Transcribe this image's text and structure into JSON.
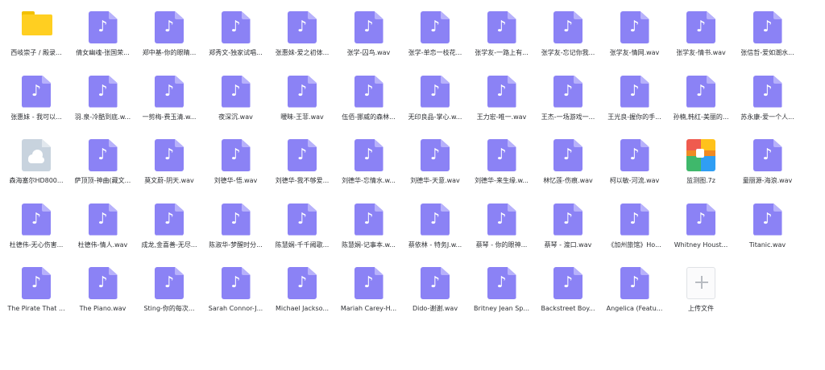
{
  "items": [
    {
      "type": "folder",
      "name": "西岐崇子 / 殿录..."
    },
    {
      "type": "audio",
      "name": "倩女幽魂-张国荣..."
    },
    {
      "type": "audio",
      "name": "郑中基-你的眼睛..."
    },
    {
      "type": "audio",
      "name": "郑秀文-独家试唱..."
    },
    {
      "type": "audio",
      "name": "张惠妹-爱之初体..."
    },
    {
      "type": "audio",
      "name": "张学-囚鸟.wav"
    },
    {
      "type": "audio",
      "name": "张学-单恋一枝花..."
    },
    {
      "type": "audio",
      "name": "张学友-一路上有..."
    },
    {
      "type": "audio",
      "name": "张学友-忘记你我..."
    },
    {
      "type": "audio",
      "name": "张学友-情网.wav"
    },
    {
      "type": "audio",
      "name": "张学友-情书.wav"
    },
    {
      "type": "audio",
      "name": "张信哲-爱如潮水..."
    },
    {
      "type": "audio",
      "name": "张惠妹 - 我可以..."
    },
    {
      "type": "audio",
      "name": "羽.泉-冷酷到底.w..."
    },
    {
      "type": "audio",
      "name": "一剪梅-费玉清.w..."
    },
    {
      "type": "audio",
      "name": "夜深沉.wav"
    },
    {
      "type": "audio",
      "name": "暧昧-王菲.wav"
    },
    {
      "type": "audio",
      "name": "伍佰-挪威的森林..."
    },
    {
      "type": "audio",
      "name": "无印良品-掌心.w..."
    },
    {
      "type": "audio",
      "name": "王力宏-唯一.wav"
    },
    {
      "type": "audio",
      "name": "王杰-一场游戏一..."
    },
    {
      "type": "audio",
      "name": "王光良-握你的手..."
    },
    {
      "type": "audio",
      "name": "孙楠,韩红-美丽的..."
    },
    {
      "type": "audio",
      "name": "苏永康-爱一个人..."
    },
    {
      "type": "cloud",
      "name": "森海塞尔HD800..."
    },
    {
      "type": "audio",
      "name": "萨顶顶-神曲(藏文..."
    },
    {
      "type": "audio",
      "name": "莫文蔚-阴天.wav"
    },
    {
      "type": "audio",
      "name": "刘德华-悟.wav"
    },
    {
      "type": "audio",
      "name": "刘德华-我不够爱..."
    },
    {
      "type": "audio",
      "name": "刘德华-忘情水.w..."
    },
    {
      "type": "audio",
      "name": "刘德华-天意.wav"
    },
    {
      "type": "audio",
      "name": "刘德华-来生缘.w..."
    },
    {
      "type": "audio",
      "name": "林忆莲-伤痕.wav"
    },
    {
      "type": "audio",
      "name": "柯以敏-河流.wav"
    },
    {
      "type": "zip",
      "name": "监测图.7z"
    },
    {
      "type": "audio",
      "name": "童丽源-海浪.wav"
    },
    {
      "type": "audio",
      "name": "杜德伟-无心伤害..."
    },
    {
      "type": "audio",
      "name": "杜德伟-情人.wav"
    },
    {
      "type": "audio",
      "name": "成龙,金喜善-无尽..."
    },
    {
      "type": "audio",
      "name": "陈淑华-梦醒时分..."
    },
    {
      "type": "audio",
      "name": "陈慧娴-千千阙歌..."
    },
    {
      "type": "audio",
      "name": "陈慧娴-记事本.w..."
    },
    {
      "type": "audio",
      "name": "蔡依林 - 特务J.w..."
    },
    {
      "type": "audio",
      "name": "蔡琴 - 你的眼神..."
    },
    {
      "type": "audio",
      "name": "蔡琴 - 渡口.wav"
    },
    {
      "type": "audio",
      "name": "《加州旅馆》Ho..."
    },
    {
      "type": "audio",
      "name": "Whitney Houst..."
    },
    {
      "type": "audio",
      "name": "Titanic.wav"
    },
    {
      "type": "audio",
      "name": "The Pirate That ..."
    },
    {
      "type": "audio",
      "name": "The Piano.wav"
    },
    {
      "type": "audio",
      "name": "Sting-你的每次..."
    },
    {
      "type": "audio",
      "name": "Sarah Connor-J..."
    },
    {
      "type": "audio",
      "name": "Michael Jackso..."
    },
    {
      "type": "audio",
      "name": "Mariah Carey-H..."
    },
    {
      "type": "audio",
      "name": "Dido-谢谢.wav"
    },
    {
      "type": "audio",
      "name": "Britney Jean Sp..."
    },
    {
      "type": "audio",
      "name": "Backstreet Boy..."
    },
    {
      "type": "audio",
      "name": "Angelica (Featu..."
    },
    {
      "type": "upload",
      "name": "上传文件"
    }
  ],
  "icons": {
    "audio": "music-file-icon",
    "folder": "folder-icon",
    "cloud": "cloud-file-icon",
    "zip": "archive-icon",
    "upload": "plus-icon",
    "note_glyph": "♪"
  },
  "colors": {
    "audio": "#8b82f5",
    "folder": "#ffcf21",
    "cloud": "#c8d3de",
    "text": "#2d2f33"
  }
}
